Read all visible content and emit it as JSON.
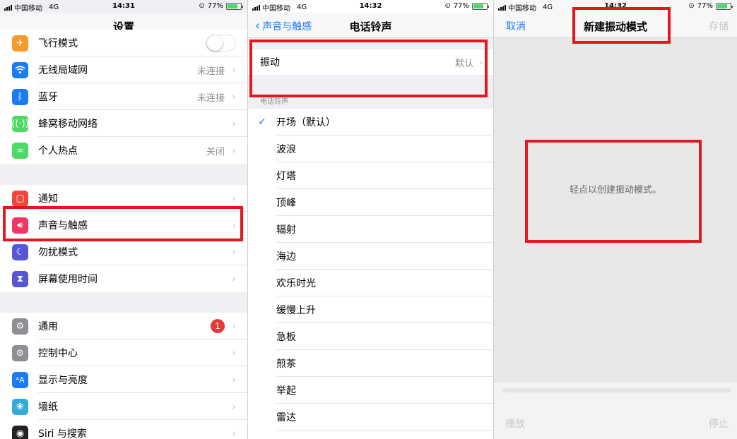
{
  "status": [
    {
      "carrier": "中国移动",
      "network": "4G",
      "time": "14:31",
      "battery": "77%"
    },
    {
      "carrier": "中国移动",
      "network": "4G",
      "time": "14:32",
      "battery": "77%"
    },
    {
      "carrier": "中国移动",
      "network": "4G",
      "time": "14:32",
      "battery": "77%"
    }
  ],
  "settings": {
    "title": "设置",
    "items": [
      {
        "label": "飞行模式",
        "value": "",
        "icon": "airplane-icon",
        "color": "#f79a2a"
      },
      {
        "label": "无线局域网",
        "value": "未连接",
        "icon": "wifi-icon",
        "color": "#1a7cf5"
      },
      {
        "label": "蓝牙",
        "value": "未连接",
        "icon": "bluetooth-icon",
        "color": "#1a7cf5"
      },
      {
        "label": "蜂窝移动网络",
        "value": "",
        "icon": "cellular-icon",
        "color": "#4cd964"
      },
      {
        "label": "个人热点",
        "value": "关闭",
        "icon": "hotspot-icon",
        "color": "#4cd964"
      },
      {
        "label": "通知",
        "value": "",
        "icon": "notification-icon",
        "color": "#f2453d"
      },
      {
        "label": "声音与触感",
        "value": "",
        "icon": "speaker-icon",
        "color": "#f2365f"
      },
      {
        "label": "勿扰模式",
        "value": "",
        "icon": "moon-icon",
        "color": "#5856d6"
      },
      {
        "label": "屏幕使用时间",
        "value": "",
        "icon": "hourglass-icon",
        "color": "#5856d6"
      },
      {
        "label": "通用",
        "value": "",
        "icon": "gear-icon",
        "color": "#8e8e93",
        "badge": "1"
      },
      {
        "label": "控制中心",
        "value": "",
        "icon": "control-center-icon",
        "color": "#8e8e93"
      },
      {
        "label": "显示与亮度",
        "value": "",
        "icon": "display-icon",
        "color": "#1a7cf5"
      },
      {
        "label": "墙纸",
        "value": "",
        "icon": "wallpaper-icon",
        "color": "#34aadc"
      },
      {
        "label": "Siri 与搜索",
        "value": "",
        "icon": "siri-icon",
        "color": "#222222"
      }
    ]
  },
  "ringtone": {
    "back": "声音与触感",
    "title": "电话铃声",
    "vibration_label": "振动",
    "vibration_value": "默认",
    "section_header": "电话铃声",
    "tones": [
      "开场（默认）",
      "波浪",
      "灯塔",
      "顶峰",
      "辐射",
      "海边",
      "欢乐时光",
      "缓慢上升",
      "急板",
      "煎茶",
      "举起",
      "雷达"
    ],
    "selected_index": 0
  },
  "vibration": {
    "cancel": "取消",
    "title": "新建振动模式",
    "save": "存储",
    "hint": "轻点以创建振动模式。",
    "play": "播放",
    "stop": "停止"
  }
}
